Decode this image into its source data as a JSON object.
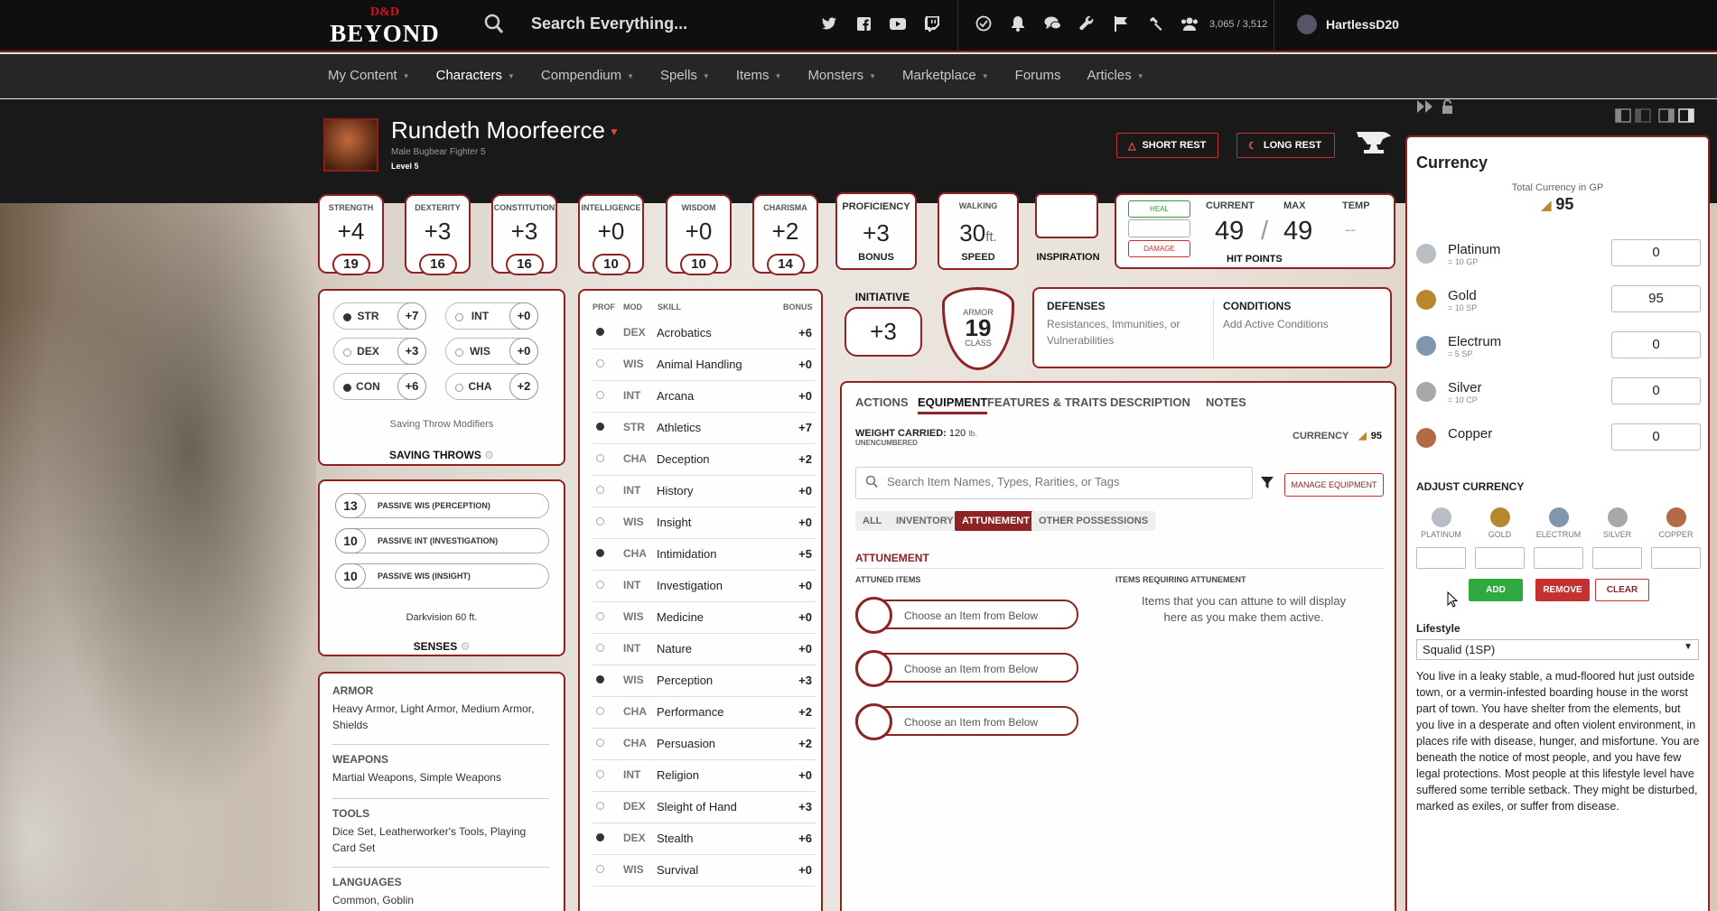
{
  "topbar": {
    "logo_top": "D&D",
    "logo_bottom": "BEYOND",
    "search_placeholder": "Search Everything...",
    "social_icons": [
      "twitter-icon",
      "facebook-icon",
      "youtube-icon",
      "twitch-icon"
    ],
    "tool_icons": [
      "dice-icon",
      "bell-icon",
      "chat-icon",
      "wrench-icon",
      "flag-icon",
      "hammer-icon",
      "group-icon"
    ],
    "count": "3,065 / 3,512",
    "username": "HartlessD20"
  },
  "nav": {
    "items": [
      {
        "label": "My Content",
        "caret": true
      },
      {
        "label": "Characters",
        "caret": true,
        "active": true
      },
      {
        "label": "Compendium",
        "caret": true
      },
      {
        "label": "Spells",
        "caret": true
      },
      {
        "label": "Items",
        "caret": true
      },
      {
        "label": "Monsters",
        "caret": true
      },
      {
        "label": "Marketplace",
        "caret": true
      },
      {
        "label": "Forums",
        "caret": false
      },
      {
        "label": "Articles",
        "caret": true
      }
    ]
  },
  "character": {
    "name": "Rundeth Moorfeerce",
    "meta": "Male  Bugbear  Fighter 5",
    "level": "Level 5",
    "short_rest": "SHORT REST",
    "long_rest": "LONG REST"
  },
  "abilities": [
    {
      "name": "STRENGTH",
      "mod": "+4",
      "score": "19"
    },
    {
      "name": "DEXTERITY",
      "mod": "+3",
      "score": "16"
    },
    {
      "name": "CONSTITUTION",
      "mod": "+3",
      "score": "16"
    },
    {
      "name": "INTELLIGENCE",
      "mod": "+0",
      "score": "10"
    },
    {
      "name": "WISDOM",
      "mod": "+0",
      "score": "10"
    },
    {
      "name": "CHARISMA",
      "mod": "+2",
      "score": "14"
    }
  ],
  "proficiency": {
    "title": "PROFICIENCY",
    "value": "+3",
    "label": "BONUS"
  },
  "speed": {
    "title": "WALKING",
    "value": "30",
    "unit": "ft.",
    "label": "SPEED"
  },
  "inspiration": {
    "label": "INSPIRATION"
  },
  "hp": {
    "heal": "HEAL",
    "damage": "DAMAGE",
    "current_label": "CURRENT",
    "max_label": "MAX",
    "temp_label": "TEMP",
    "current": "49",
    "sep": "/",
    "max": "49",
    "temp": "--",
    "title": "HIT POINTS"
  },
  "saving_throws": {
    "items": [
      {
        "ab": "STR",
        "mod": "+7",
        "prof": true
      },
      {
        "ab": "INT",
        "mod": "+0",
        "prof": false
      },
      {
        "ab": "DEX",
        "mod": "+3",
        "prof": false
      },
      {
        "ab": "WIS",
        "mod": "+0",
        "prof": false
      },
      {
        "ab": "CON",
        "mod": "+6",
        "prof": true
      },
      {
        "ab": "CHA",
        "mod": "+2",
        "prof": false
      }
    ],
    "modifiers": "Saving Throw Modifiers",
    "title": "SAVING THROWS"
  },
  "senses": {
    "items": [
      {
        "value": "13",
        "label": "PASSIVE WIS (PERCEPTION)"
      },
      {
        "value": "10",
        "label": "PASSIVE INT (INVESTIGATION)"
      },
      {
        "value": "10",
        "label": "PASSIVE WIS (INSIGHT)"
      }
    ],
    "darkvision": "Darkvision 60 ft.",
    "title": "SENSES"
  },
  "proficiencies": [
    {
      "heading": "ARMOR",
      "text": "Heavy Armor, Light Armor, Medium Armor, Shields"
    },
    {
      "heading": "WEAPONS",
      "text": "Martial Weapons, Simple Weapons"
    },
    {
      "heading": "TOOLS",
      "text": "Dice Set, Leatherworker's Tools, Playing Card Set"
    },
    {
      "heading": "LANGUAGES",
      "text": "Common, Goblin"
    }
  ],
  "skills": {
    "headers": {
      "prof": "PROF",
      "mod": "MOD",
      "skill": "SKILL",
      "bonus": "BONUS"
    },
    "items": [
      {
        "mod": "DEX",
        "name": "Acrobatics",
        "bonus": "+6",
        "prof": true
      },
      {
        "mod": "WIS",
        "name": "Animal Handling",
        "bonus": "+0",
        "prof": false
      },
      {
        "mod": "INT",
        "name": "Arcana",
        "bonus": "+0",
        "prof": false
      },
      {
        "mod": "STR",
        "name": "Athletics",
        "bonus": "+7",
        "prof": true
      },
      {
        "mod": "CHA",
        "name": "Deception",
        "bonus": "+2",
        "prof": false
      },
      {
        "mod": "INT",
        "name": "History",
        "bonus": "+0",
        "prof": false
      },
      {
        "mod": "WIS",
        "name": "Insight",
        "bonus": "+0",
        "prof": false
      },
      {
        "mod": "CHA",
        "name": "Intimidation",
        "bonus": "+5",
        "prof": true
      },
      {
        "mod": "INT",
        "name": "Investigation",
        "bonus": "+0",
        "prof": false
      },
      {
        "mod": "WIS",
        "name": "Medicine",
        "bonus": "+0",
        "prof": false
      },
      {
        "mod": "INT",
        "name": "Nature",
        "bonus": "+0",
        "prof": false
      },
      {
        "mod": "WIS",
        "name": "Perception",
        "bonus": "+3",
        "prof": true
      },
      {
        "mod": "CHA",
        "name": "Performance",
        "bonus": "+2",
        "prof": false
      },
      {
        "mod": "CHA",
        "name": "Persuasion",
        "bonus": "+2",
        "prof": false
      },
      {
        "mod": "INT",
        "name": "Religion",
        "bonus": "+0",
        "prof": false
      },
      {
        "mod": "DEX",
        "name": "Sleight of Hand",
        "bonus": "+3",
        "prof": false
      },
      {
        "mod": "DEX",
        "name": "Stealth",
        "bonus": "+6",
        "prof": true
      },
      {
        "mod": "WIS",
        "name": "Survival",
        "bonus": "+0",
        "prof": false
      }
    ]
  },
  "initiative": {
    "label": "INITIATIVE",
    "value": "+3"
  },
  "armor_class": {
    "top": "ARMOR",
    "value": "19",
    "bottom": "CLASS"
  },
  "defenses": {
    "title": "DEFENSES",
    "text": "Resistances, Immunities, or Vulnerabilities"
  },
  "conditions": {
    "title": "CONDITIONS",
    "text": "Add Active Conditions"
  },
  "tabs": [
    "ACTIONS",
    "EQUIPMENT",
    "FEATURES & TRAITS",
    "DESCRIPTION",
    "NOTES"
  ],
  "equipment": {
    "weight_label": "WEIGHT CARRIED:",
    "weight_value": "120",
    "weight_unit": "lb.",
    "encumbrance": "UNENCUMBERED",
    "currency_label": "CURRENCY",
    "currency_value": "95",
    "search_placeholder": "Search Item Names, Types, Rarities, or Tags",
    "manage": "MANAGE EQUIPMENT",
    "filters": [
      "ALL",
      "INVENTORY",
      "ATTUNEMENT",
      "OTHER POSSESSIONS"
    ],
    "attunement_title": "ATTUNEMENT",
    "attuned_label": "ATTUNED ITEMS",
    "requiring_label": "ITEMS REQUIRING ATTUNEMENT",
    "slot_text": "Choose an Item from Below",
    "requiring_msg": "Items that you can attune to will display here as you make them active."
  },
  "currency": {
    "title": "Currency",
    "total_label": "Total Currency in GP",
    "total_value": "95",
    "coins": [
      {
        "name": "Platinum",
        "rate": "= 10 GP",
        "value": "0",
        "color": "#b9bec4"
      },
      {
        "name": "Gold",
        "rate": "= 10 SP",
        "value": "95",
        "color": "#b8892c"
      },
      {
        "name": "Electrum",
        "rate": "= 5 SP",
        "value": "0",
        "color": "#7f96ad"
      },
      {
        "name": "Silver",
        "rate": "= 10 CP",
        "value": "0",
        "color": "#a9a9a9"
      },
      {
        "name": "Copper",
        "rate": "",
        "value": "0",
        "color": "#b36b47"
      }
    ],
    "adjust_title": "ADJUST CURRENCY",
    "adjust_labels": [
      "PLATINUM",
      "GOLD",
      "ELECTRUM",
      "SILVER",
      "COPPER"
    ],
    "add": "ADD",
    "remove": "REMOVE",
    "clear": "CLEAR",
    "lifestyle_label": "Lifestyle",
    "lifestyle_value": "Squalid (1SP)",
    "lifestyle_desc": "You live in a leaky stable, a mud-floored hut just outside town, or a vermin-infested boarding house in the worst part of town. You have shelter from the elements, but you live in a desperate and often violent environment, in places rife with disease, hunger, and misfortune. You are beneath the notice of most people, and you have few legal protections. Most people at this lifestyle level have suffered some terrible setback. They might be disturbed, marked as exiles, or suffer from disease."
  }
}
